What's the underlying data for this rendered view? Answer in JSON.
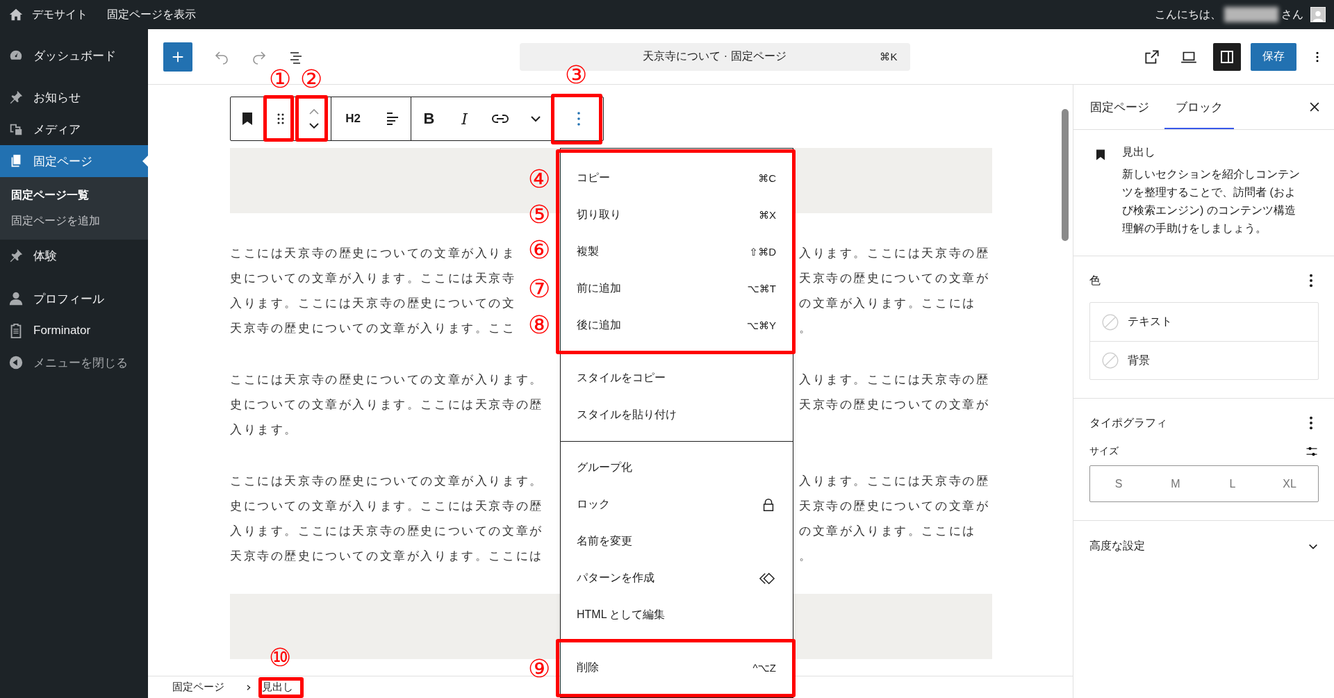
{
  "admin_bar": {
    "site_name": "デモサイト",
    "view_page": "固定ページを表示",
    "greeting": "こんにちは、",
    "honorific": "さん"
  },
  "sidebar": {
    "sections": [
      [
        {
          "label": "ダッシュボード",
          "kind": "menu",
          "selected": false
        }
      ],
      [
        {
          "label": "お知らせ",
          "kind": "menu",
          "selected": false
        },
        {
          "label": "メディア",
          "kind": "menu",
          "selected": false
        },
        {
          "label": "固定ページ",
          "kind": "menu",
          "selected": true,
          "children": [
            {
              "label": "固定ページ一覧",
              "selected": true
            },
            {
              "label": "固定ページを追加",
              "selected": false
            }
          ]
        },
        {
          "label": "体験",
          "kind": "menu",
          "selected": false
        }
      ],
      [
        {
          "label": "プロフィール",
          "kind": "menu",
          "selected": false
        },
        {
          "label": "Forminator",
          "kind": "menu",
          "selected": false
        },
        {
          "label": "メニューを閉じる",
          "kind": "collapse",
          "selected": false
        }
      ]
    ]
  },
  "header": {
    "command_text": "天京寺について · 固定ページ",
    "command_shortcut": "⌘K",
    "save_label": "保存",
    "sidebar_toggle_on": true
  },
  "block_toolbar": {
    "heading_level": "H2",
    "format_buttons": [
      "B",
      "I"
    ]
  },
  "canvas": {
    "paragraphs": [
      {
        "lines": [
          {
            "left": "ここには天京寺の歴史についての文章が入りま",
            "right": "入ります。ここには天京寺の歴"
          },
          {
            "left": "史についての文章が入ります。ここには天京寺",
            "right": "天京寺の歴史についての文章が"
          },
          {
            "left": "入ります。ここには天京寺の歴史についての文",
            "right": "の文章が入ります。ここには"
          },
          {
            "left": "天京寺の歴史についての文章が入ります。ここ",
            "right": "。"
          }
        ]
      },
      {
        "lines": [
          {
            "left": "ここには天京寺の歴史についての文章が入ります。",
            "right": "入ります。ここには天京寺の歴"
          },
          {
            "left": "史についての文章が入ります。ここには天京寺の歴",
            "right": "天京寺の歴史についての文章が"
          },
          {
            "left": "入ります。"
          }
        ]
      },
      {
        "lines": [
          {
            "left": "ここには天京寺の歴史についての文章が入ります。",
            "right": "入ります。ここには天京寺の歴"
          },
          {
            "left": "史についての文章が入ります。ここには天京寺の歴",
            "right": "天京寺の歴史についての文章が"
          },
          {
            "left": "入ります。ここには天京寺の歴史についての文章が",
            "right": "の文章が入ります。ここには"
          },
          {
            "left": "天京寺の歴史についての文章が入ります。ここには",
            "right": "。"
          }
        ]
      }
    ]
  },
  "options_menu": {
    "groups": [
      [
        {
          "label": "コピー",
          "kind": "shortcut",
          "shortcut": "⌘C"
        },
        {
          "label": "切り取り",
          "kind": "shortcut",
          "shortcut": "⌘X"
        },
        {
          "label": "複製",
          "kind": "shortcut",
          "shortcut": "⇧⌘D"
        },
        {
          "label": "前に追加",
          "kind": "shortcut",
          "shortcut": "⌥⌘T"
        },
        {
          "label": "後に追加",
          "kind": "shortcut",
          "shortcut": "⌥⌘Y"
        }
      ],
      [
        {
          "label": "スタイルをコピー",
          "kind": "plain"
        },
        {
          "label": "スタイルを貼り付け",
          "kind": "plain"
        }
      ],
      [
        {
          "label": "グループ化",
          "kind": "plain"
        },
        {
          "label": "ロック",
          "kind": "lock"
        },
        {
          "label": "名前を変更",
          "kind": "plain"
        },
        {
          "label": "パターンを作成",
          "kind": "pattern"
        },
        {
          "label": "HTML として編集",
          "kind": "plain"
        }
      ],
      [
        {
          "label": "削除",
          "kind": "shortcut",
          "shortcut": "^⌥Z"
        }
      ]
    ]
  },
  "breadcrumb": [
    "固定ページ",
    "見出し"
  ],
  "settings_panel": {
    "tabs": [
      {
        "label": "固定ページ",
        "selected": false
      },
      {
        "label": "ブロック",
        "selected": true
      }
    ],
    "block": {
      "title": "見出し",
      "description": "新しいセクションを紹介しコンテンツを整理することで、訪問者 (および検索エンジン) のコンテンツ構造理解の手助けをしましょう。"
    },
    "color": {
      "title": "色",
      "options": [
        "テキスト",
        "背景"
      ]
    },
    "typography": {
      "title": "タイポグラフィ",
      "size_label": "サイズ",
      "sizes": [
        "S",
        "M",
        "L",
        "XL"
      ]
    },
    "advanced": {
      "title": "高度な設定",
      "expanded": false
    }
  },
  "annotations": [
    {
      "label": "①"
    },
    {
      "label": "②"
    },
    {
      "label": "③"
    },
    {
      "label": "④"
    },
    {
      "label": "⑤"
    },
    {
      "label": "⑥"
    },
    {
      "label": "⑦"
    },
    {
      "label": "⑧"
    },
    {
      "label": "⑨"
    },
    {
      "label": "⑩"
    }
  ]
}
